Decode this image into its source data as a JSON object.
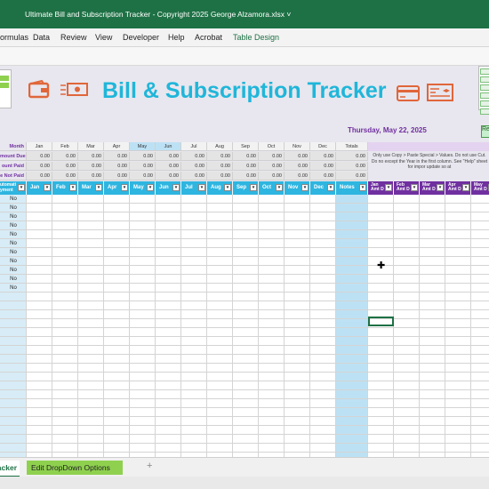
{
  "window": {
    "title": "Ultimate Bill and Subscription Tracker - Copyright 2025 George Alzamora.xlsx ˅"
  },
  "ribbon": {
    "tabs": [
      "ormulas",
      "Data",
      "Review",
      "View",
      "Developer",
      "Help",
      "Acrobat",
      "Table Design"
    ],
    "active": "Table Design"
  },
  "sheet": {
    "title": "Bill & Subscription Tracker",
    "date": "Thursday, May 22, 2025",
    "months": [
      "Jan",
      "Feb",
      "Mar",
      "Apr",
      "May",
      "Jun",
      "Jul",
      "Aug",
      "Sep",
      "Oct",
      "Nov",
      "Dec"
    ],
    "totals_label": "Totals",
    "summary_rows": [
      {
        "label": "Month",
        "values": []
      },
      {
        "label": "mount Due",
        "values": [
          "0.00",
          "0.00",
          "0.00",
          "0.00",
          "0.00",
          "0.00",
          "0.00",
          "0.00",
          "0.00",
          "0.00",
          "0.00",
          "0.00"
        ],
        "total": "0.00"
      },
      {
        "label": "ount Paid",
        "values": [
          "0.00",
          "0.00",
          "0.00",
          "0.00",
          "0.00",
          "0.00",
          "0.00",
          "0.00",
          "0.00",
          "0.00",
          "0.00",
          "0.00"
        ],
        "total": "0.00"
      },
      {
        "label": "e Not Paid",
        "values": [
          "0.00",
          "0.00",
          "0.00",
          "0.00",
          "0.00",
          "0.00",
          "0.00",
          "0.00",
          "0.00",
          "0.00",
          "0.00",
          "0.00"
        ],
        "total": "0.00"
      }
    ],
    "note": "Only use Copy > Paste Special > Values. Do not use Cut. Do no except the Year in the first column. See \"Help\" sheet for impor update so at",
    "table_headers": {
      "first": "utomati\nyment",
      "months": [
        "Jan",
        "Feb",
        "Mar",
        "Apr",
        "May",
        "Jun",
        "Jul",
        "Aug",
        "Sep",
        "Oct",
        "Nov",
        "Dec"
      ],
      "notes": "Notes",
      "paid": [
        "Jan\nAmt D",
        "Feb\nAmt D",
        "Mar\nAmt D",
        "Apr\nAmt D",
        "May\nAmt D"
      ]
    },
    "autopay_values": [
      "No",
      "No",
      "No",
      "No",
      "No",
      "No",
      "No",
      "No",
      "No",
      "No",
      "No"
    ],
    "right_button": "Re"
  },
  "sheet_tabs": {
    "active": "acker",
    "second": "Edit DropDown Options",
    "add": "+"
  },
  "colors": {
    "title": "#1fb6d9",
    "header": "#2eb5e0",
    "purple": "#7030a0",
    "excel_green": "#1e7145",
    "icon_orange": "#e0663a"
  }
}
